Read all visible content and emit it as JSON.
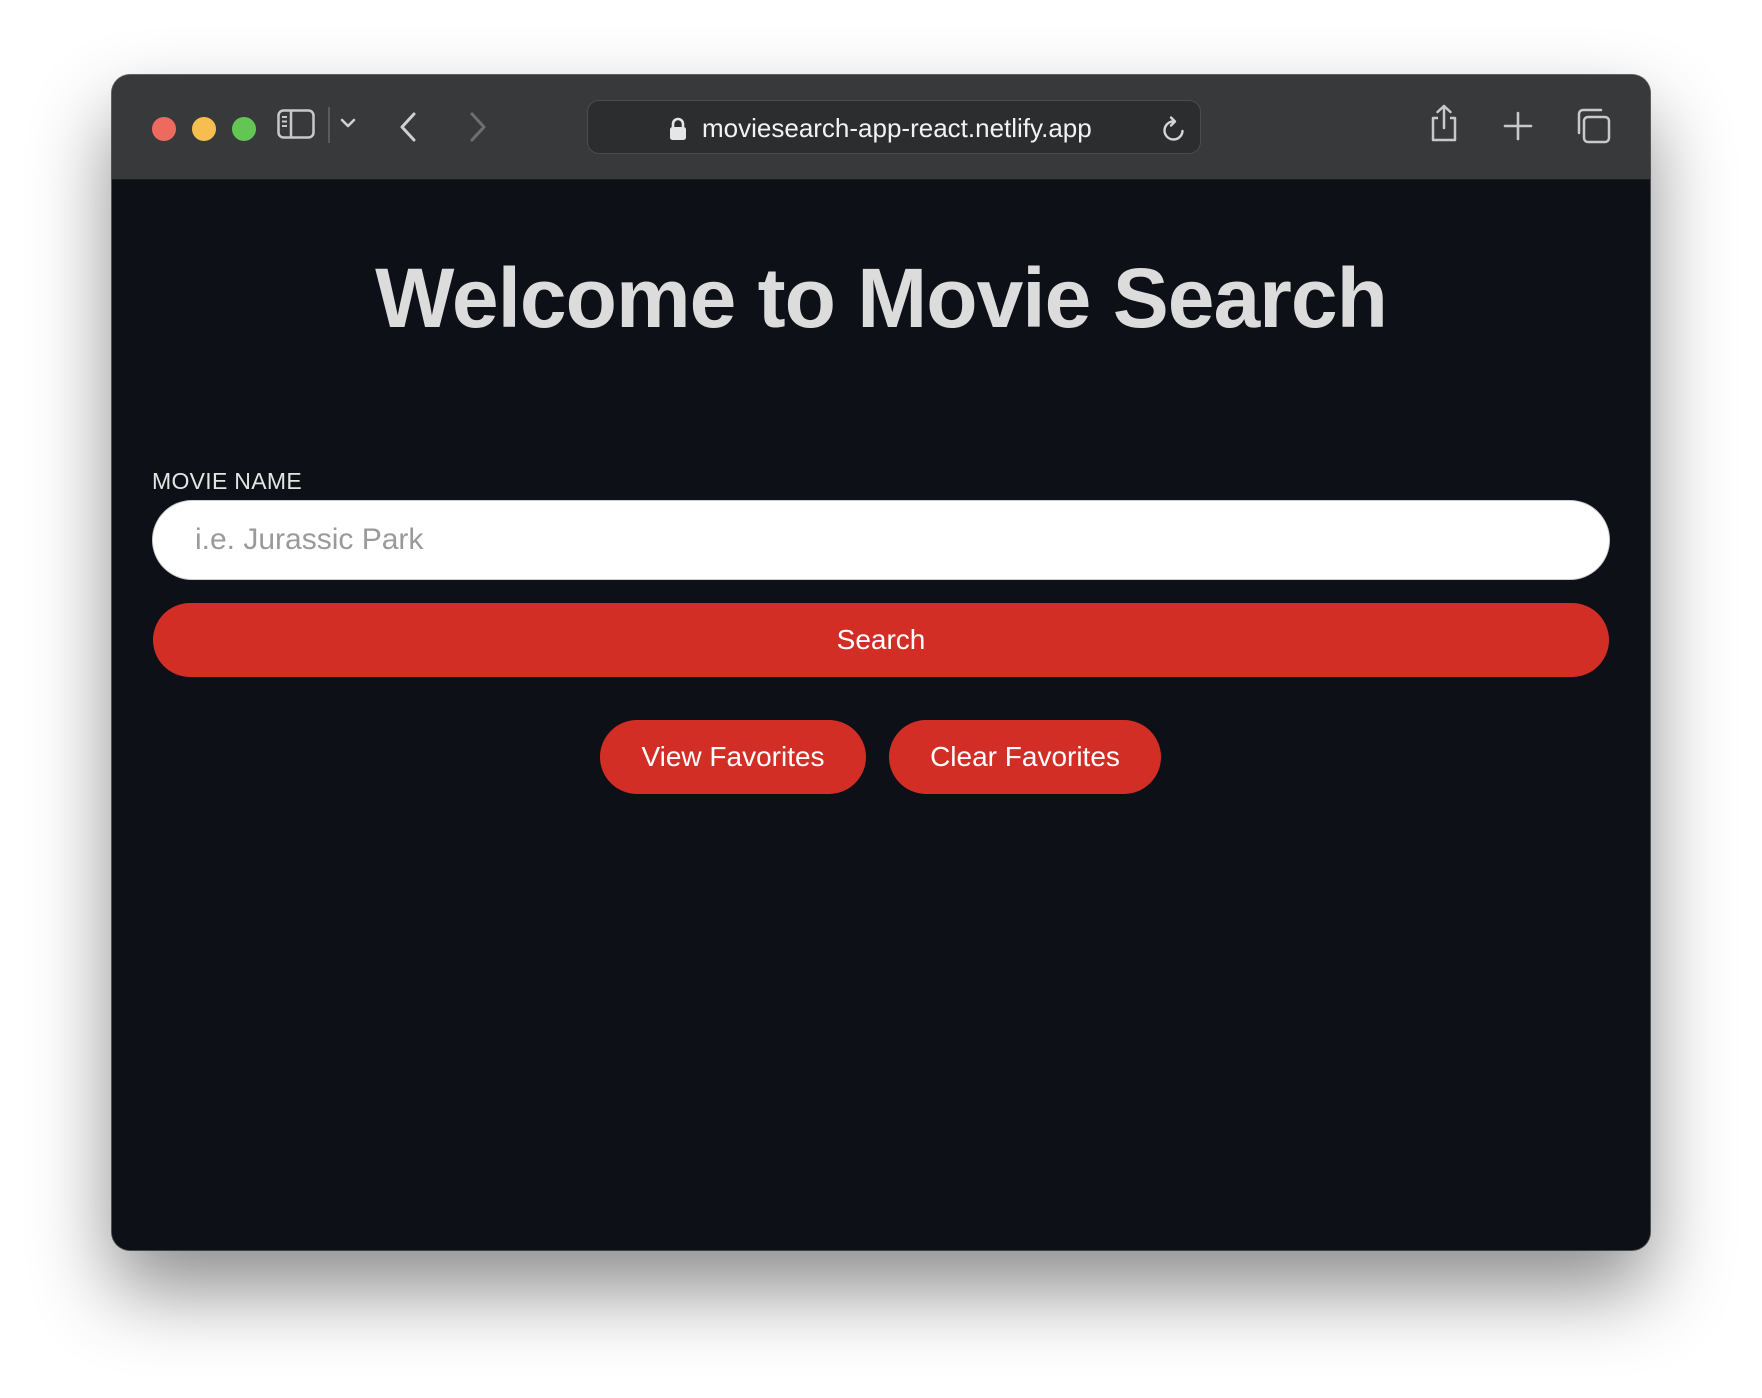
{
  "browser": {
    "url": "moviesearch-app-react.netlify.app",
    "icons": {
      "close": "close-window-icon",
      "minimize": "minimize-window-icon",
      "zoom": "zoom-window-icon",
      "sidebar": "sidebar-icon",
      "sidebar_menu": "chevron-down-icon",
      "back": "back-icon",
      "forward": "forward-icon",
      "lock": "lock-icon",
      "reload": "reload-icon",
      "share": "share-icon",
      "new_tab": "plus-icon",
      "tabs_overview": "tabs-overview-icon"
    },
    "colors": {
      "close": "#ee6a5f",
      "minimize": "#f5be4f",
      "zoom": "#62c554"
    }
  },
  "page": {
    "title": "Welcome to Movie Search",
    "search": {
      "label": "MOVIE NAME",
      "placeholder": "i.e. Jurassic Park",
      "value": "",
      "button_label": "Search"
    },
    "actions": {
      "view_favorites": "View Favorites",
      "clear_favorites": "Clear Favorites"
    },
    "colors": {
      "background": "#0d1016",
      "accent": "#d32e26",
      "title": "#dcdcdc"
    }
  }
}
